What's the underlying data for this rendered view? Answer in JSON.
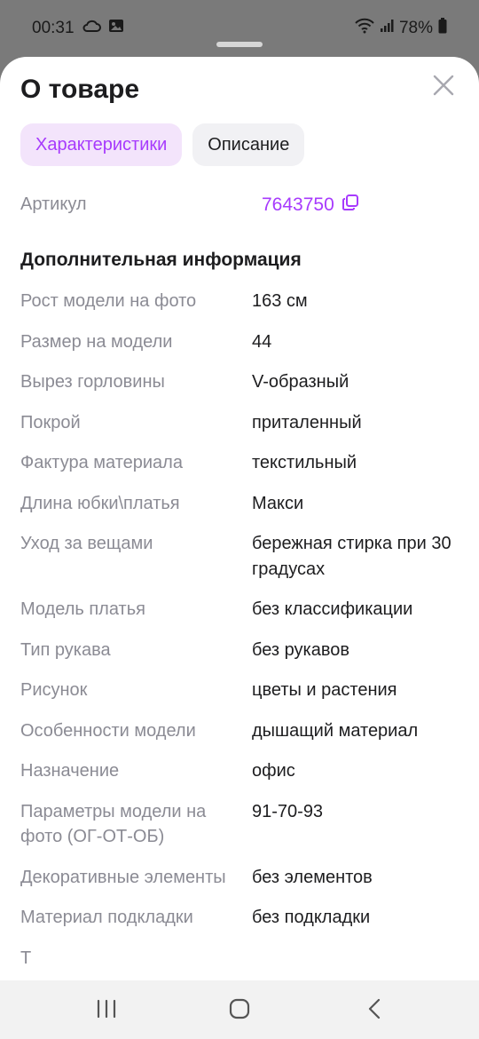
{
  "status_bar": {
    "time": "00:31",
    "battery": "78%",
    "icons": [
      "cloud-icon",
      "image-icon",
      "wifi-icon",
      "signal-icon",
      "battery-icon"
    ]
  },
  "sheet": {
    "title": "О товаре",
    "close_icon": "close-icon"
  },
  "tabs": [
    {
      "label": "Характеристики",
      "active": true
    },
    {
      "label": "Описание",
      "active": false
    }
  ],
  "article": {
    "label": "Артикул",
    "value": "7643750",
    "copy_icon": "copy-icon"
  },
  "additional_info": {
    "title": "Дополнительная информация",
    "specs": [
      {
        "name": "Рост модели на фото",
        "value": "163 см"
      },
      {
        "name": "Размер на модели",
        "value": "44"
      },
      {
        "name": "Вырез горловины",
        "value": "V-образный"
      },
      {
        "name": "Покрой",
        "value": "приталенный"
      },
      {
        "name": "Фактура материала",
        "value": "текстильный"
      },
      {
        "name": "Длина юбки\\платья",
        "value": "Макси"
      },
      {
        "name": "Уход за вещами",
        "value": "бережная стирка при 30 градусах"
      },
      {
        "name": "Модель платья",
        "value": "без классификации"
      },
      {
        "name": "Тип рукава",
        "value": "без рукавов"
      },
      {
        "name": "Рисунок",
        "value": "цветы и растения"
      },
      {
        "name": "Особенности модели",
        "value": "дышащий материал"
      },
      {
        "name": "Назначение",
        "value": "офис"
      },
      {
        "name": "Параметры модели на фото (ОГ-ОТ-ОБ)",
        "value": "91-70-93"
      },
      {
        "name": "Декоративные элементы",
        "value": "без элементов"
      },
      {
        "name": "Материал подкладки",
        "value": "без подкладки"
      },
      {
        "name": "Т",
        "value": ""
      }
    ]
  },
  "nav_bar": {
    "buttons": [
      "recent-apps-icon",
      "home-icon",
      "back-icon"
    ]
  },
  "colors": {
    "accent": "#a73afd",
    "accent_bg": "#f3e4fb",
    "muted_text": "#8b8b94",
    "text": "#1d1d1f"
  }
}
